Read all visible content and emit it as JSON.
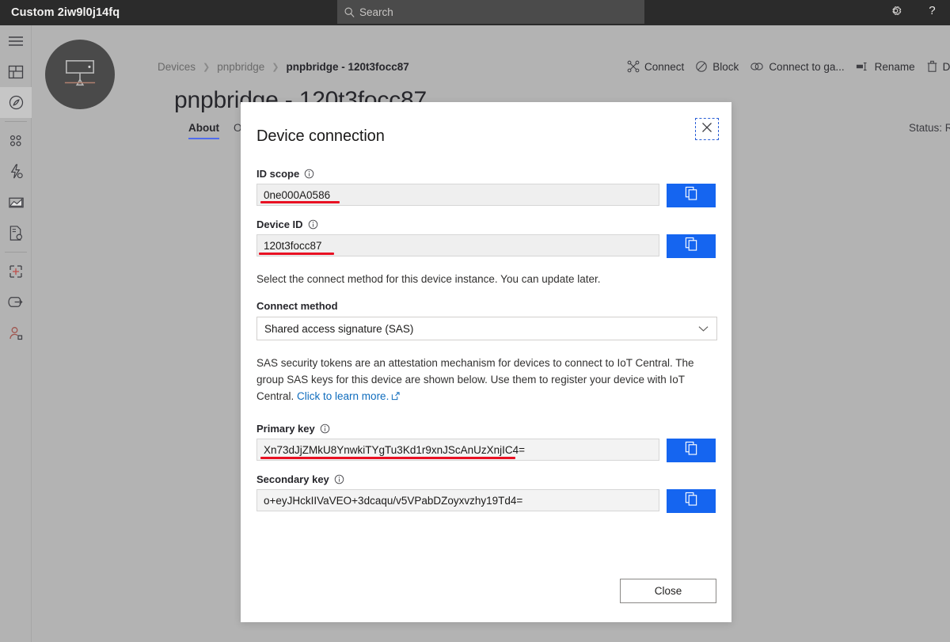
{
  "topbar": {
    "app_title": "Custom 2iw9l0j14fq",
    "search_placeholder": "Search",
    "settings_icon": "gear-icon",
    "help_icon": "question-mark-icon"
  },
  "rail": {
    "items": [
      {
        "name": "hamburger-menu",
        "label": "Menu"
      },
      {
        "name": "dashboard",
        "label": "Dashboard"
      },
      {
        "name": "devices",
        "label": "Devices"
      },
      {
        "name": "device-groups",
        "label": "Device groups"
      },
      {
        "name": "rules",
        "label": "Rules"
      },
      {
        "name": "analytics",
        "label": "Analytics"
      },
      {
        "name": "jobs",
        "label": "Jobs"
      },
      {
        "name": "device-templates",
        "label": "Device templates"
      },
      {
        "name": "data-export",
        "label": "Data export"
      },
      {
        "name": "administration",
        "label": "Administration"
      }
    ]
  },
  "page": {
    "breadcrumb": [
      {
        "label": "Devices",
        "current": false
      },
      {
        "label": "pnpbridge",
        "current": false
      },
      {
        "label": "pnpbridge - 120t3focc87",
        "current": true
      }
    ],
    "title": "pnpbridge - 120t3focc87",
    "tabs": [
      {
        "label": "About",
        "active": true
      },
      {
        "label": "Overview",
        "active": false
      }
    ],
    "status": "Status: Registere",
    "commands": [
      {
        "label": "Connect",
        "icon": "connect-icon"
      },
      {
        "label": "Block",
        "icon": "block-icon"
      },
      {
        "label": "Connect to ga...",
        "icon": "link-icon"
      },
      {
        "label": "Rename",
        "icon": "rename-icon"
      },
      {
        "label": "Delet",
        "icon": "delete-icon"
      }
    ]
  },
  "dialog": {
    "title": "Device connection",
    "close_icon": "close-icon",
    "id_scope": {
      "label": "ID scope",
      "value": "0ne000A0586",
      "copy_icon": "copy-icon",
      "info_icon": "info-icon"
    },
    "device_id": {
      "label": "Device ID",
      "value": "120t3focc87",
      "copy_icon": "copy-icon",
      "info_icon": "info-icon"
    },
    "hint": "Select the connect method for this device instance. You can update later.",
    "connect_method": {
      "label": "Connect method",
      "selected": "Shared access signature (SAS)",
      "chevron_icon": "chevron-down-icon"
    },
    "sas_description_1": "SAS security tokens are an attestation mechanism for devices to connect to IoT Central. The",
    "sas_description_2": "group SAS keys for this device are shown below. Use them to register your device with IoT",
    "sas_description_3": "Central. ",
    "sas_link": "Click to learn more.",
    "primary_key": {
      "label": "Primary key",
      "value": "Xn73dJjZMkU8YnwkiTYgTu3Kd1r9xnJScAnUzXnjIC4=",
      "copy_icon": "copy-icon",
      "info_icon": "info-icon"
    },
    "secondary_key": {
      "label": "Secondary key",
      "value": "o+eyJHckIIVaVEO+3dcaqu/v5VPabDZoyxvzhy19Td4=",
      "copy_icon": "copy-icon",
      "info_icon": "info-icon"
    },
    "close_button": "Close"
  },
  "colors": {
    "topbar_bg": "#2b2b2b",
    "page_bg": "#b3b3b3",
    "accent_blue": "#1565f0",
    "link_blue": "#0f6cbd",
    "annotation_red": "#e81123",
    "tab_underline": "#4f6bed"
  }
}
